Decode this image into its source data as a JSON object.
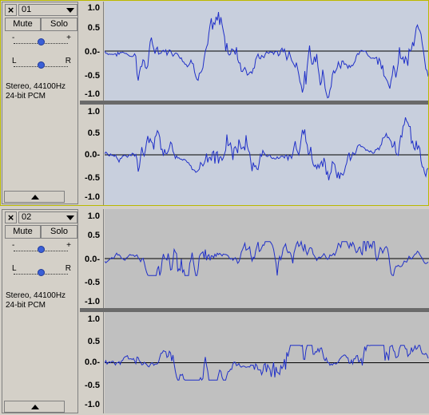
{
  "tracks": [
    {
      "name": "01",
      "mute_label": "Mute",
      "solo_label": "Solo",
      "gain_min_label": "-",
      "gain_max_label": "+",
      "pan_left_label": "L",
      "pan_right_label": "R",
      "gain_value": 0.5,
      "pan_value": 0.5,
      "format_line1": "Stereo, 44100Hz",
      "format_line2": "24-bit PCM",
      "selected": true,
      "wave_bg": "#c8cfdd",
      "ruler_ticks": [
        "1.0",
        "0.5",
        "0.0-",
        "-0.5",
        "-1.0"
      ]
    },
    {
      "name": "02",
      "mute_label": "Mute",
      "solo_label": "Solo",
      "gain_min_label": "-",
      "gain_max_label": "+",
      "pan_left_label": "L",
      "pan_right_label": "R",
      "gain_value": 0.5,
      "pan_value": 0.5,
      "format_line1": "Stereo, 44100Hz",
      "format_line2": "24-bit PCM",
      "selected": false,
      "wave_bg": "#c0c0c0",
      "ruler_ticks": [
        "1.0",
        "0.5",
        "0.0-",
        "-0.5",
        "-1.0"
      ]
    }
  ],
  "colors": {
    "waveform": "#2030c8",
    "zero_line": "#000000",
    "selection_border": "#b9b900"
  }
}
